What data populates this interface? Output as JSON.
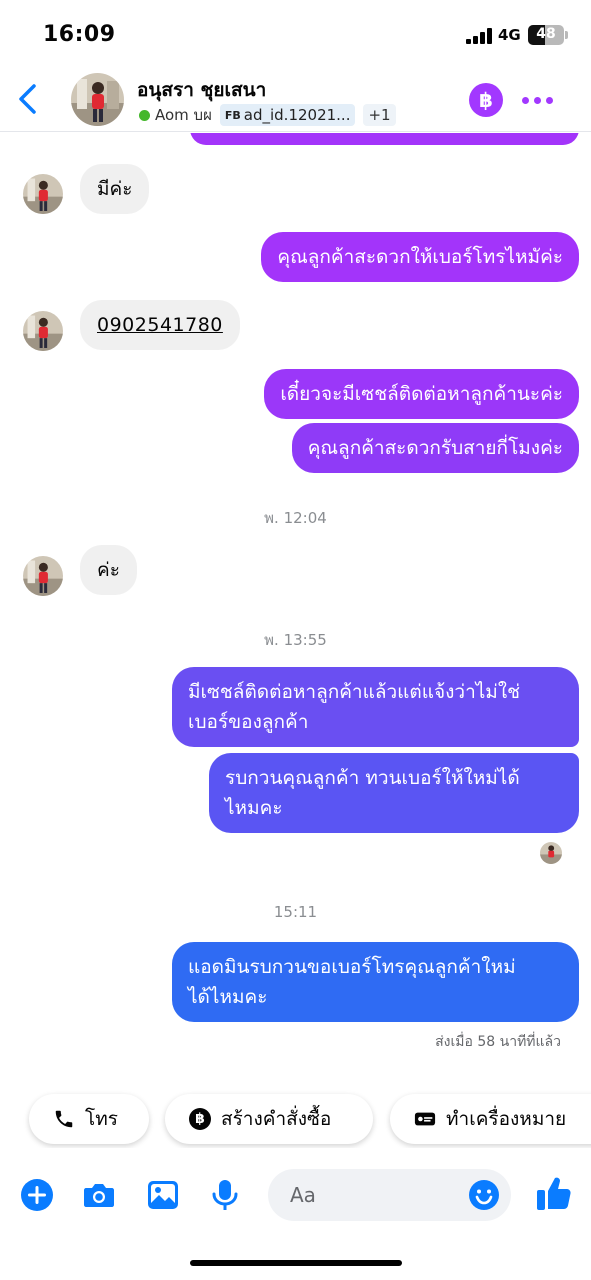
{
  "status_bar": {
    "time": "16:09",
    "network": "4G",
    "battery": "48",
    "battery_level": 0.48
  },
  "header": {
    "contact_name": "อนุสรา ชุยเสนา",
    "assignee": "Aom บผ",
    "tag_prefix": "FB",
    "tag_label": "ad_id.12021...",
    "more_tags": "+1",
    "baht_icon": "฿"
  },
  "messages": [
    {
      "id": "m1",
      "direction": "in",
      "text": "มีค่ะ"
    },
    {
      "id": "m2",
      "direction": "out",
      "text": "คุณลูกค้าสะดวกให้เบอร์โทรไหมัค่ะ"
    },
    {
      "id": "m3",
      "direction": "in",
      "text": "0902541780"
    },
    {
      "id": "m4",
      "direction": "out",
      "text": "เดี๋ยวจะมีเซชล์ติดต่อหาลูกค้านะค่ะ"
    },
    {
      "id": "m5",
      "direction": "out",
      "text": "คุณลูกค้าสะดวกรับสายกี่โมงค่ะ"
    },
    {
      "id": "m6",
      "direction": "in",
      "text": "ค่ะ"
    },
    {
      "id": "m7",
      "direction": "out",
      "lines": [
        "มีเซชล์ติดต่อหาลูกค้าแล้วแต่แจ้งว่าไม่ใช่",
        "เบอร์ของลูกค้า"
      ]
    },
    {
      "id": "m8",
      "direction": "out",
      "lines": [
        "รบกวนคุณลูกค้า ทวนเบอร์ให้ใหม่ได้",
        "ไหมคะ"
      ]
    },
    {
      "id": "m9",
      "direction": "out",
      "lines": [
        "แอดมินรบกวนขอเบอร์โทรคุณลูกค้าใหม่",
        "ได้ไหมคะ"
      ]
    }
  ],
  "timestamps": {
    "t1": "พ. 12:04",
    "t2": "พ. 13:55",
    "t3": "15:11"
  },
  "sent_status": "ส่งเมื่อ 58 นาทีที่แล้ว",
  "quick_actions": [
    {
      "label": "โทร",
      "icon": "phone-icon"
    },
    {
      "label": "สร้างคำสั่งซื้อ",
      "icon": "baht-icon"
    },
    {
      "label": "ทำเครื่องหมาย",
      "icon": "label-card-icon"
    }
  ],
  "composer": {
    "placeholder": "Aa",
    "icons": [
      "plus-icon",
      "camera-icon",
      "gallery-icon",
      "microphone-icon",
      "emoji-icon",
      "thumbs-up-icon"
    ]
  },
  "colors": {
    "bubble_purple": "#a334fa",
    "bubble_indigo": "#6a4ff2",
    "bubble_blue": "#2f6bf3",
    "accent_purple": "#a238ff",
    "icon_blue": "#0a7cff",
    "incoming_bg": "#f0f0f0"
  }
}
